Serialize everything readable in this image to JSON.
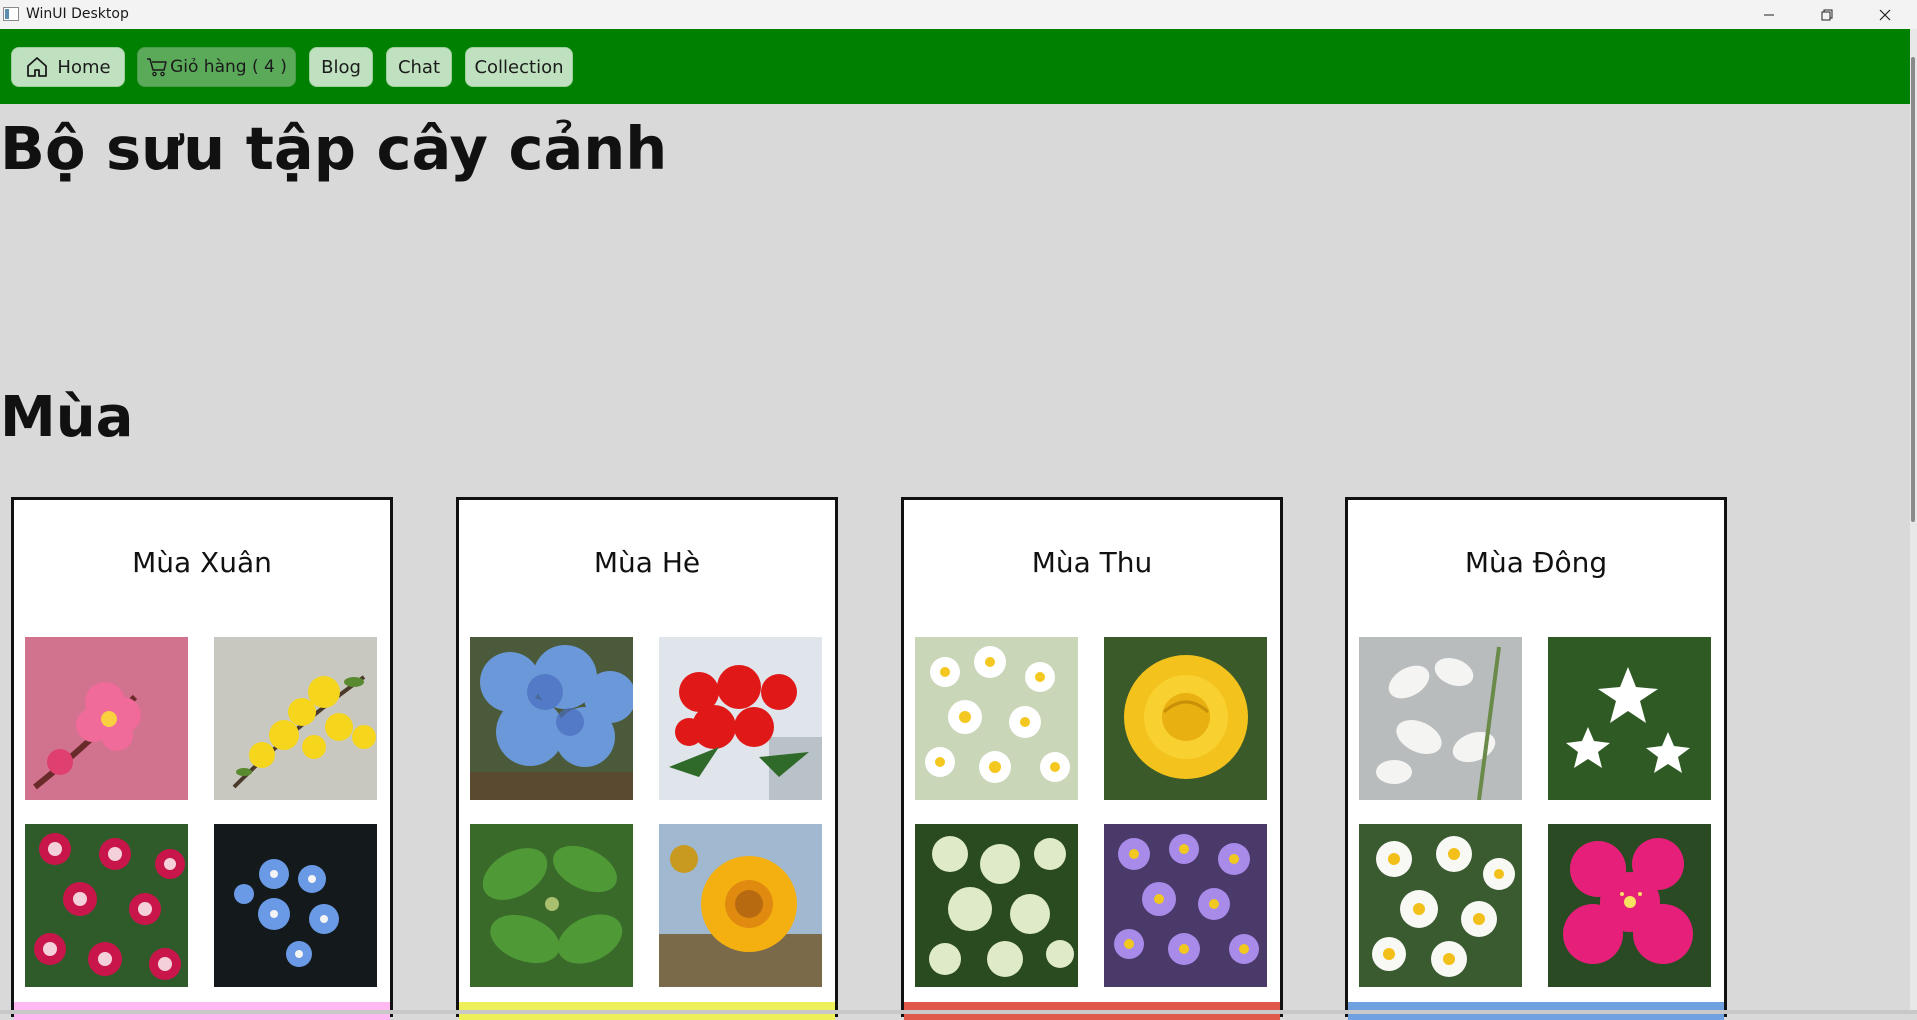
{
  "window": {
    "title": "WinUI Desktop"
  },
  "nav": {
    "home_label": "Home",
    "cart_label": "Giỏ hàng ( 4 )",
    "blog_label": "Blog",
    "chat_label": "Chat",
    "collection_label": "Collection"
  },
  "page": {
    "title": "Bộ sưu tập cây cảnh",
    "section_title": "Mùa"
  },
  "seasons": [
    {
      "title": "Mùa Xuân",
      "accent": "#ffb8f0"
    },
    {
      "title": "Mùa Hè",
      "accent": "#eef05a"
    },
    {
      "title": "Mùa Thu",
      "accent": "#e0584a"
    },
    {
      "title": "Mùa Đông",
      "accent": "#6fa0e0"
    }
  ],
  "icons": {
    "home": "home-icon",
    "cart": "cart-icon",
    "minimize": "minimize-icon",
    "maximize": "restore-icon",
    "close": "close-icon"
  },
  "colors": {
    "navbar": "#008000",
    "background": "#d9d9d9"
  }
}
